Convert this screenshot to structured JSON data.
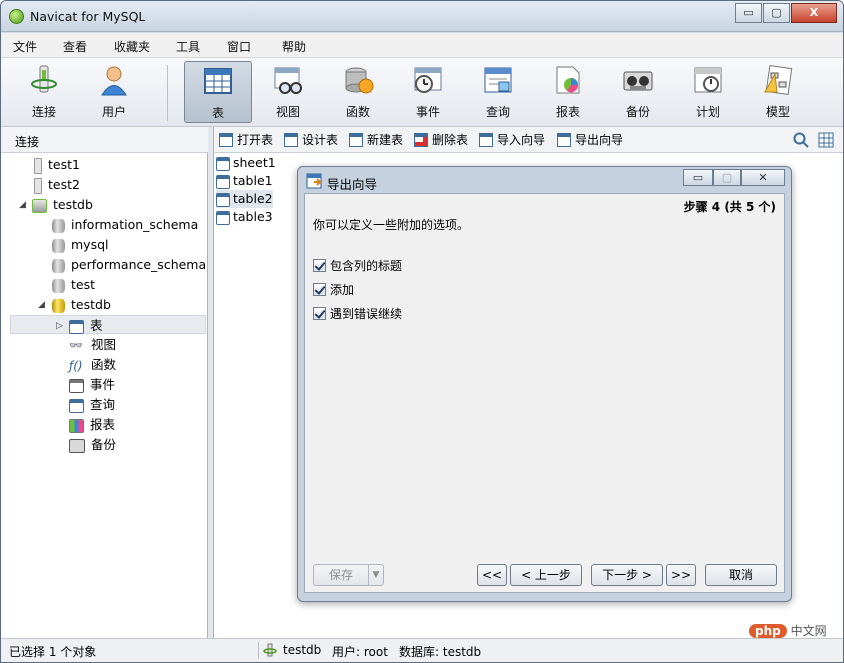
{
  "window": {
    "title": "Navicat for MySQL",
    "min": "▭",
    "max": "▢",
    "close": "X"
  },
  "menu": [
    "文件",
    "查看",
    "收藏夹",
    "工具",
    "窗口",
    "帮助"
  ],
  "toolbar": [
    "连接",
    "用户",
    "表",
    "视图",
    "函数",
    "事件",
    "查询",
    "报表",
    "备份",
    "计划",
    "模型"
  ],
  "left_pane": {
    "header": "连接",
    "tree": [
      "test1",
      "test2",
      "testdb",
      "information_schema",
      "mysql",
      "performance_schema",
      "test",
      "testdb",
      "表",
      "视图",
      "函数",
      "事件",
      "查询",
      "报表",
      "备份"
    ]
  },
  "object_toolbar": [
    "打开表",
    "设计表",
    "新建表",
    "删除表",
    "导入向导",
    "导出向导"
  ],
  "objects": [
    "sheet1",
    "table1",
    "table2",
    "table3"
  ],
  "dialog": {
    "title": "导出向导",
    "step": "步骤 4 (共 5 个)",
    "description": "你可以定义一些附加的选项。",
    "options": [
      "包含列的标题",
      "添加",
      "遇到错误继续"
    ],
    "buttons": {
      "save": "保存",
      "first": "<<",
      "prev": "< 上一步",
      "next": "下一步 >",
      "last": ">>",
      "cancel": "取消"
    }
  },
  "status": {
    "selection": "已选择 1 个对象",
    "connection": "testdb",
    "user": "用户: root",
    "database": "数据库: testdb"
  },
  "watermark": {
    "badge": "php",
    "text": "中文网"
  }
}
